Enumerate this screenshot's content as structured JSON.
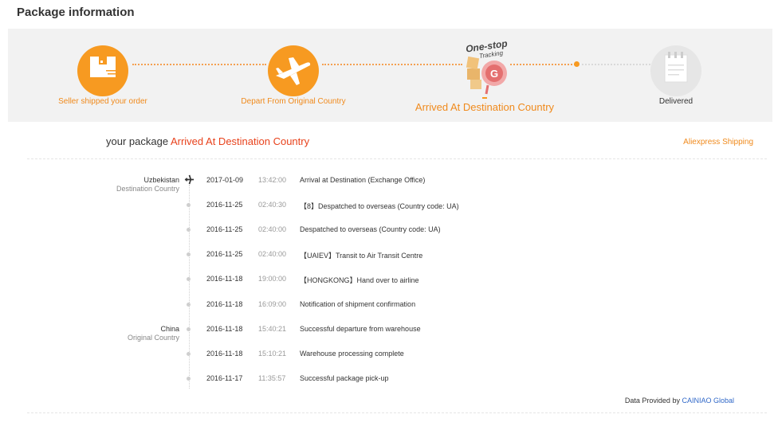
{
  "page": {
    "title": "Package information"
  },
  "progress": {
    "brand": {
      "line1": "One-stop",
      "line2": "Tracking"
    },
    "steps": [
      {
        "label": "Seller shipped your order",
        "icon": "box-icon",
        "state": "done"
      },
      {
        "label": "Depart From Original Country",
        "icon": "airplane-icon",
        "state": "done"
      },
      {
        "label": "Arrived At Destination Country",
        "icon": "cainiao-logo-icon",
        "state": "current"
      },
      {
        "label": "Delivered",
        "icon": "receipt-icon",
        "state": "pending"
      }
    ]
  },
  "summary": {
    "prefix": "your package",
    "status": "Arrived At Destination Country",
    "shipping_method": "Aliexpress Shipping"
  },
  "events": [
    {
      "place": "Uzbekistan",
      "role": "Destination Country",
      "date": "2017-01-09",
      "time": "13:42:00",
      "desc": "Arrival at Destination (Exchange Office)"
    },
    {
      "place": "",
      "role": "",
      "date": "2016-11-25",
      "time": "02:40:30",
      "desc": "【8】Despatched to overseas (Country code: UA)"
    },
    {
      "place": "",
      "role": "",
      "date": "2016-11-25",
      "time": "02:40:00",
      "desc": "Despatched to overseas (Country code: UA)"
    },
    {
      "place": "",
      "role": "",
      "date": "2016-11-25",
      "time": "02:40:00",
      "desc": "【UAIEV】Transit to Air Transit Centre"
    },
    {
      "place": "",
      "role": "",
      "date": "2016-11-18",
      "time": "19:00:00",
      "desc": "【HONGKONG】Hand over to airline"
    },
    {
      "place": "",
      "role": "",
      "date": "2016-11-18",
      "time": "16:09:00",
      "desc": "Notification of shipment confirmation"
    },
    {
      "place": "China",
      "role": "Original Country",
      "date": "2016-11-18",
      "time": "15:40:21",
      "desc": "Successful departure from warehouse"
    },
    {
      "place": "",
      "role": "",
      "date": "2016-11-18",
      "time": "15:10:21",
      "desc": "Warehouse processing complete"
    },
    {
      "place": "",
      "role": "",
      "date": "2016-11-17",
      "time": "11:35:57",
      "desc": "Successful package pick-up"
    }
  ],
  "footer": {
    "prefix": "Data Provided by",
    "provider": "CAINIAO Global"
  },
  "colors": {
    "accent": "#f79a21",
    "status": "#e8421c",
    "link": "#3068c8"
  }
}
